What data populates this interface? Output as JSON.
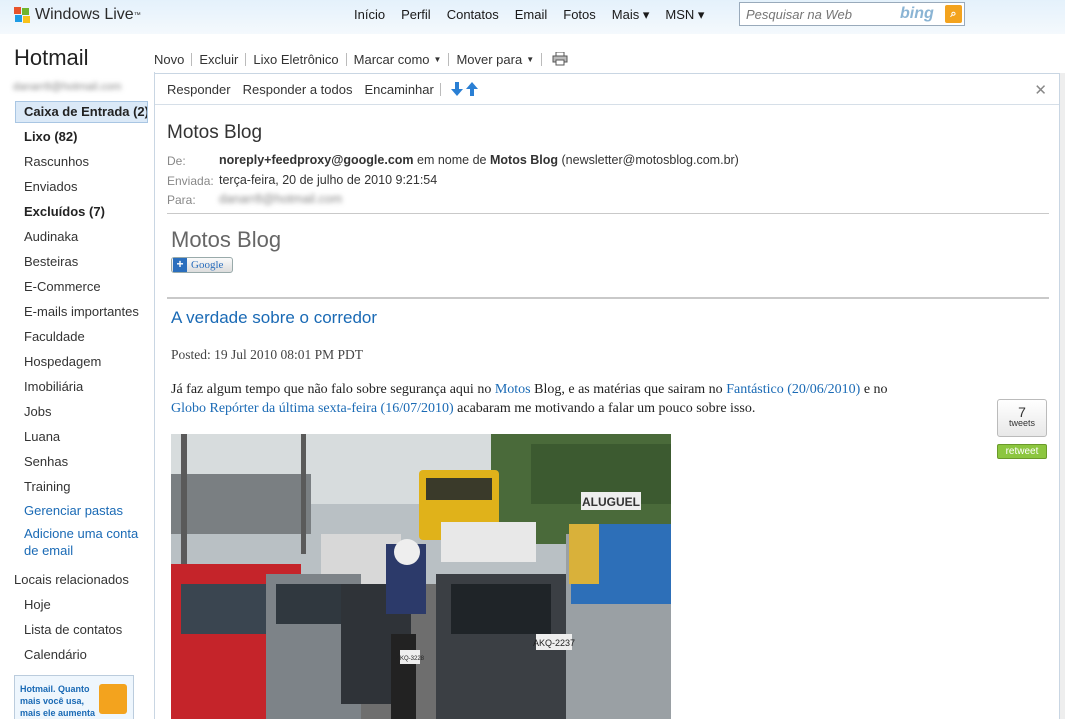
{
  "topbar": {
    "brand": "Windows Live",
    "brand_tm": "™",
    "nav": [
      {
        "label": "Início"
      },
      {
        "label": "Perfil"
      },
      {
        "label": "Contatos"
      },
      {
        "label": "Email"
      },
      {
        "label": "Fotos"
      },
      {
        "label": "Mais ▾"
      },
      {
        "label": "MSN ▾"
      }
    ],
    "search": {
      "placeholder": "Pesquisar na Web",
      "engine": "bing"
    }
  },
  "sidebar": {
    "title": "Hotmail",
    "account": "danarr8@hotmail.com",
    "folders": [
      {
        "label": "Caixa de Entrada (2)"
      },
      {
        "label": "Lixo (82)"
      },
      {
        "label": "Rascunhos"
      },
      {
        "label": "Enviados"
      },
      {
        "label": "Excluídos (7)"
      },
      {
        "label": "Audinaka"
      },
      {
        "label": "Besteiras"
      },
      {
        "label": "E-Commerce"
      },
      {
        "label": "E-mails importantes"
      },
      {
        "label": "Faculdade"
      },
      {
        "label": "Hospedagem"
      },
      {
        "label": "Imobiliária"
      },
      {
        "label": "Jobs"
      },
      {
        "label": "Luana"
      },
      {
        "label": "Senhas"
      },
      {
        "label": "Training"
      }
    ],
    "manage_folders": "Gerenciar pastas",
    "add_account": [
      "Adicione uma conta",
      "de email"
    ],
    "related_title": "Locais relacionados",
    "related": [
      {
        "label": "Hoje"
      },
      {
        "label": "Lista de contatos"
      },
      {
        "label": "Calendário"
      }
    ],
    "promo": [
      "Hotmail. Quanto",
      "mais você usa,",
      "mais ele aumenta"
    ]
  },
  "toolbar": {
    "new": "Novo",
    "delete": "Excluir",
    "junk": "Lixo Eletrônico",
    "mark_as": "Marcar como",
    "move_to": "Mover para"
  },
  "message": {
    "actions": {
      "reply": "Responder",
      "reply_all": "Responder a todos",
      "forward": "Encaminhar"
    },
    "subject": "Motos Blog",
    "from_label": "De:",
    "from_addr": "noreply+feedproxy@google.com",
    "from_mid": "em nome de",
    "from_name": "Motos Blog",
    "from_real": "(newsletter@motosblog.com.br)",
    "sent_label": "Enviada:",
    "sent_value": "terça-feira, 20 de julho de 2010 9:21:54",
    "to_label": "Para:",
    "to_value": "danarr8@hotmail.com",
    "blog_title": "Motos Blog",
    "google_button": "Google",
    "post_title": "A verdade sobre o corredor",
    "posted": "Posted: 19 Jul 2010 08:01 PM PDT",
    "body": {
      "t1": "Já faz algum tempo que não falo sobre segurança aqui no ",
      "link1": "Motos",
      "t2": " Blog, e as matérias que sairam no ",
      "link2": "Fantástico (20/06/2010)",
      "t3": " e no ",
      "link3": "Globo Repórter da última sexta-feira (16/07/2010)",
      "t4": " acabaram me motivando a falar um pouco sobre isso."
    },
    "tweets": {
      "count": "7",
      "label": "tweets",
      "retweet": "retweet"
    },
    "photo_signs": {
      "sign": "ALUGUEL",
      "plate1": "AKQ-2237",
      "plate2": "AKQ-3228"
    }
  },
  "colors": {
    "link": "#1a6ab5",
    "inbox_highlight": "#dbe9f7",
    "retweet": "#8cc63f"
  }
}
